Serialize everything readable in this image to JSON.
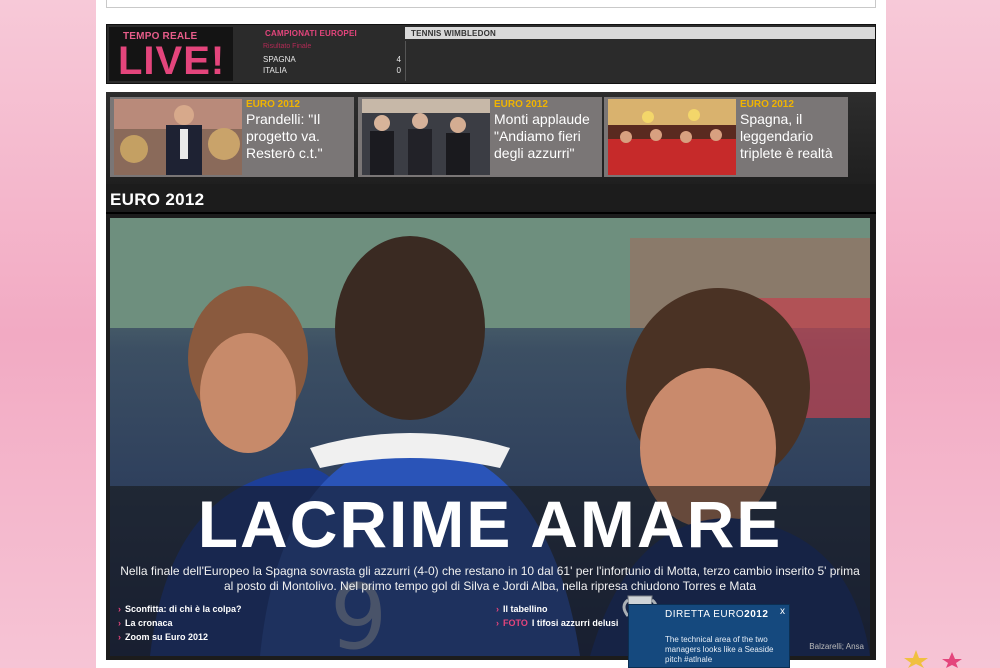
{
  "live_bar": {
    "subtitle": "TEMPO REALE",
    "logo": "LIVE!",
    "tab_euro": "CAMPIONATI EUROPEI",
    "tab_wimbledon": "TENNIS WIMBLEDON",
    "match_label": "Risultato Finale",
    "team1": "SPAGNA",
    "score1": "4",
    "team2": "ITALIA",
    "score2": "0"
  },
  "news": [
    {
      "tag": "EURO 2012",
      "title": "Prandelli: \"Il progetto va. Resterò c.t.\""
    },
    {
      "tag": "EURO 2012",
      "title": "Monti applaude \"Andiamo fieri degli azzurri\""
    },
    {
      "tag": "EURO 2012",
      "title": "Spagna, il leggendario triplete è realtà"
    }
  ],
  "section": {
    "title": "EURO 2012"
  },
  "hero": {
    "title": "LACRIME AMARE",
    "description": "Nella finale dell'Europeo la Spagna sovrasta gli azzurri (4-0) che restano in 10 dal 61' per l'infortunio di Motta, terzo cambio inserito 5' prima al posto di Montolivo. Nel primo tempo gol di Silva e Jordi Alba, nella ripresa chiudono Torres e Mata",
    "links_left": [
      "Sconfitta: di chi è la colpa?",
      "La cronaca",
      "Zoom su Euro 2012"
    ],
    "links_right": [
      "Il tabellino",
      "I tifosi azzurri delusi"
    ],
    "photo_label": "FOTO",
    "credit": "Balzarelli; Ansa"
  },
  "diretta": {
    "title_prefix": "DIRETTA EURO",
    "title_year": "2012",
    "text": "The technical area of the two managers looks like a Seaside pitch #atlnale",
    "close": "x"
  },
  "colors": {
    "live_pink": "#e4457c",
    "tag_yellow": "#f0b400",
    "page_bg": "#f2aac3"
  }
}
